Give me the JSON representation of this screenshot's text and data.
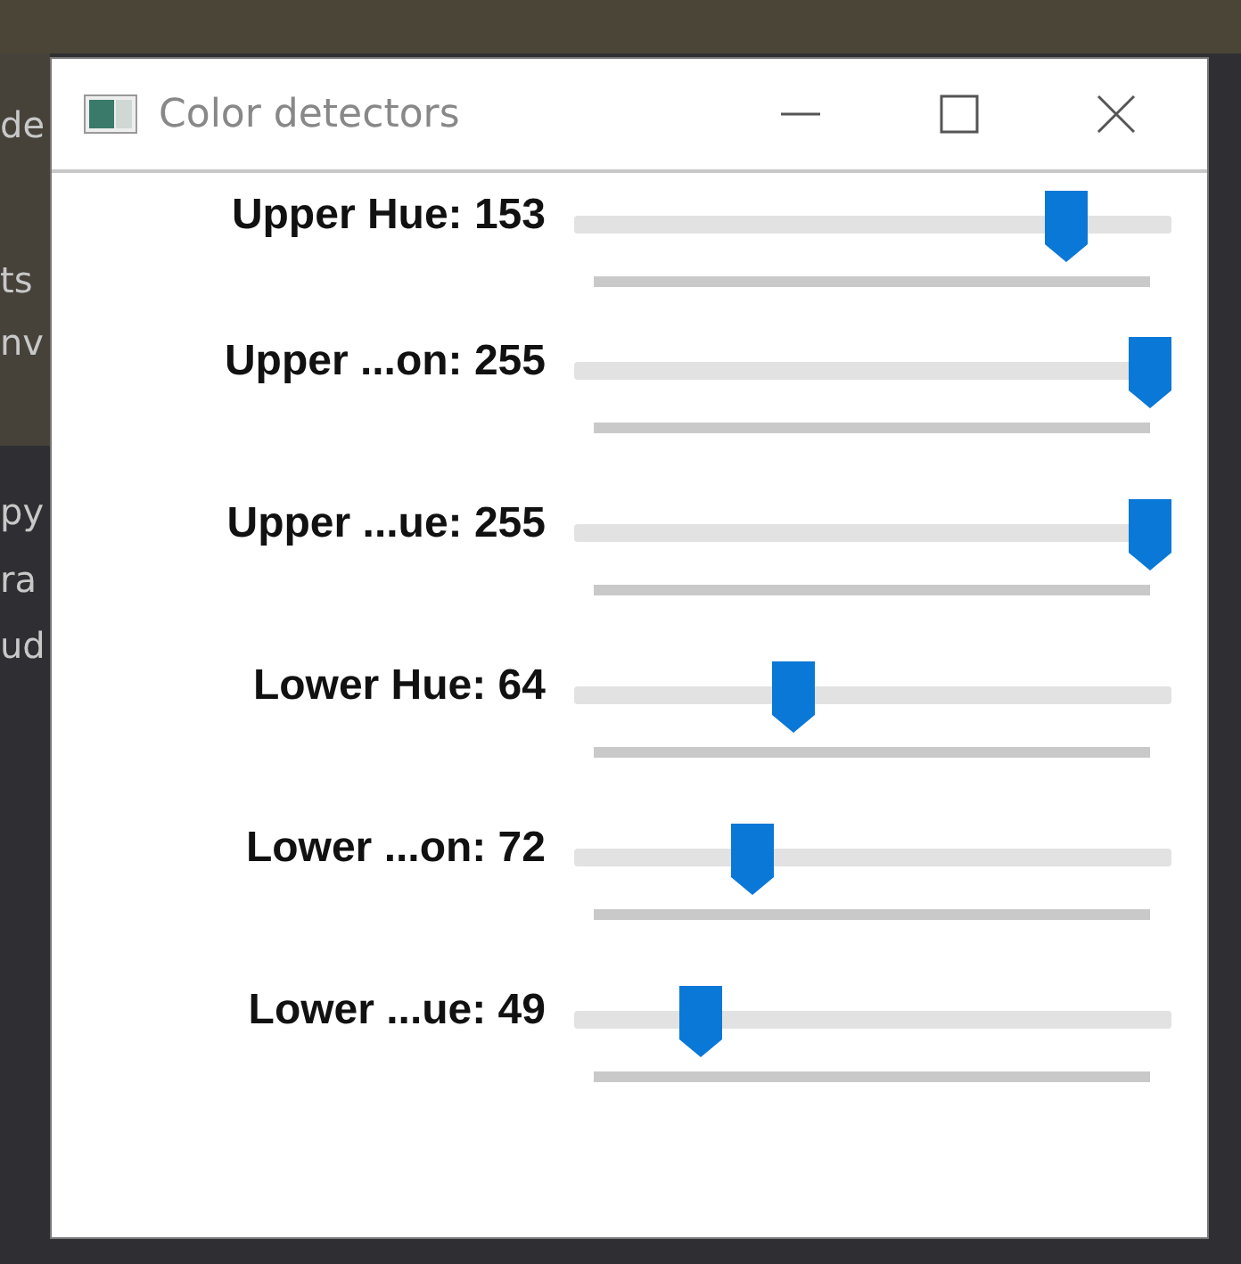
{
  "background_fragments": [
    "de",
    "ts",
    "nv",
    "py",
    "ra",
    "ud"
  ],
  "window": {
    "title": "Color detectors"
  },
  "trackbars": [
    {
      "label": "Upper Hue: 153",
      "level": 0.85
    },
    {
      "label": "Upper ...on: 255",
      "level": 1
    },
    {
      "label": "Upper ...ue: 255",
      "level": 1
    },
    {
      "label": "Lower Hue: 64",
      "level": 0.356
    },
    {
      "label": "Lower ...on: 72",
      "level": 0.282
    },
    {
      "label": "Lower ...ue: 49",
      "level": 0.19
    }
  ]
}
